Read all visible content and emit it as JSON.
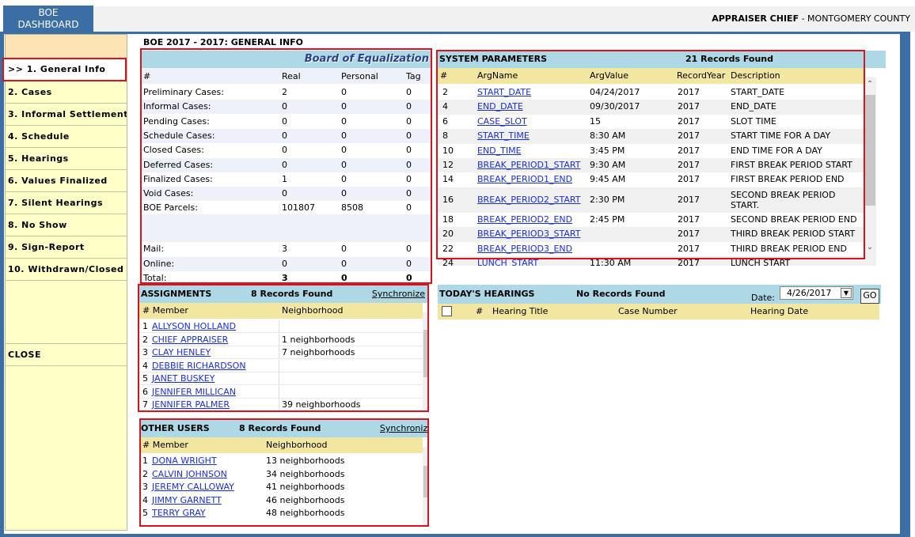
{
  "header": {
    "logo_line1": "BOE",
    "logo_line2": "DASHBOARD",
    "user_role": "APPRAISER CHIEF",
    "user_county": "- MONTGOMERY COUNTY"
  },
  "sidebar": {
    "active_item": ">> 1. General Info",
    "items": [
      "2. Cases",
      "3. Informal Settlements",
      "4. Schedule",
      "5. Hearings",
      "6. Values Finalized",
      "7. Silent Hearings",
      "8. No Show",
      "9. Sign-Report",
      "10. Withdrawn/Closed"
    ],
    "close_label": "CLOSE"
  },
  "page_title": "BOE 2017 - 2017: GENERAL INFO",
  "board": {
    "title": "Board of Equalization",
    "columns": [
      "#",
      "Real",
      "Personal",
      "Tag"
    ],
    "rows": [
      [
        "Preliminary Cases:",
        "2",
        "0",
        "0"
      ],
      [
        "Informal Cases:",
        "0",
        "0",
        "0"
      ],
      [
        "Pending Cases:",
        "0",
        "0",
        "0"
      ],
      [
        "Schedule Cases:",
        "0",
        "0",
        "0"
      ],
      [
        "Closed Cases:",
        "0",
        "0",
        "0"
      ],
      [
        "Deferred Cases:",
        "0",
        "0",
        "0"
      ],
      [
        "Finalized Cases:",
        "1",
        "0",
        "0"
      ],
      [
        "Void Cases:",
        "0",
        "0",
        "0"
      ],
      [
        "BOE Parcels:",
        "101807",
        "8508",
        "0"
      ]
    ],
    "rows2": [
      [
        "Mail:",
        "3",
        "0",
        "0"
      ],
      [
        "Online:",
        "0",
        "0",
        "0"
      ],
      [
        "Total:",
        "3",
        "0",
        "0"
      ]
    ]
  },
  "system_parameters": {
    "title": "SYSTEM PARAMETERS",
    "count": "21 Records Found",
    "columns": [
      "#",
      "ArgName",
      "ArgValue",
      "RecordYear",
      "Description"
    ],
    "rows": [
      [
        "2",
        "START_DATE",
        "04/24/2017",
        "2017",
        "START_DATE"
      ],
      [
        "4",
        "END_DATE",
        "09/30/2017",
        "2017",
        "END_DATE"
      ],
      [
        "6",
        "CASE_SLOT",
        "15",
        "2017",
        "SLOT TIME"
      ],
      [
        "8",
        "START_TIME",
        "8:30 AM",
        "2017",
        "START TIME FOR A DAY"
      ],
      [
        "10",
        "END_TIME",
        "3:45 PM",
        "2017",
        "END TIME FOR A DAY"
      ],
      [
        "12",
        "BREAK_PERIOD1_START",
        "9:30 AM",
        "2017",
        "FIRST BREAK PERIOD START"
      ],
      [
        "14",
        "BREAK_PERIOD1_END",
        "9:45 AM",
        "2017",
        "FIRST BREAK PERIOD END"
      ],
      [
        "16",
        "BREAK_PERIOD2_START",
        "2:30 PM",
        "2017",
        "SECOND BREAK PERIOD START."
      ],
      [
        "18",
        "BREAK_PERIOD2_END",
        "2:45 PM",
        "2017",
        "SECOND BREAK PERIOD END"
      ],
      [
        "20",
        "BREAK_PERIOD3_START",
        "",
        "2017",
        "THIRD BREAK PERIOD START"
      ],
      [
        "22",
        "BREAK_PERIOD3_END",
        "",
        "2017",
        "THIRD BREAK PERIOD END"
      ],
      [
        "24",
        "LUNCH_START",
        "11:30 AM",
        "2017",
        "LUNCH START"
      ]
    ]
  },
  "assignments": {
    "title": "ASSIGNMENTS",
    "count": "8 Records Found",
    "sync_label": "Synchronize",
    "columns": [
      "# Member",
      "Neighborhood"
    ],
    "rows": [
      [
        "1",
        "ALLYSON HOLLAND",
        ""
      ],
      [
        "2",
        "CHIEF APPRAISER",
        "1 neighborhoods"
      ],
      [
        "3",
        "CLAY HENLEY",
        "7 neighborhoods"
      ],
      [
        "4",
        "DEBBIE RICHARDSON",
        ""
      ],
      [
        "5",
        "JANET BUSKEY",
        ""
      ],
      [
        "6",
        "JENNIFER MILLICAN",
        ""
      ],
      [
        "7",
        "JENNIFER PALMER",
        "39 neighborhoods"
      ]
    ]
  },
  "other_users": {
    "title": "OTHER USERS",
    "count": "8 Records Found",
    "sync_label": "Synchronize",
    "columns": [
      "# Member",
      "Neighborhood"
    ],
    "rows": [
      [
        "1",
        "DONA WRIGHT",
        "13 neighborhoods"
      ],
      [
        "2",
        "CALVIN JOHNSON",
        "34 neighborhoods"
      ],
      [
        "3",
        "JEREMY CALLOWAY",
        "41 neighborhoods"
      ],
      [
        "4",
        "JIMMY GARNETT",
        "46 neighborhoods"
      ],
      [
        "5",
        "TERRY GRAY",
        "48 neighborhoods"
      ]
    ]
  },
  "hearings": {
    "title": "TODAY'S HEARINGS",
    "count": "No Records Found",
    "date_label": "Date:",
    "date_value": "4/26/2017",
    "go_label": "GO",
    "columns": [
      "#",
      "Hearing Title",
      "Case Number",
      "Hearing Date"
    ]
  },
  "icons": {
    "scroll_up": "chevron-up-icon",
    "scroll_down": "chevron-down-icon",
    "dropdown": "dropdown-arrow-icon"
  },
  "colors": {
    "frame_blue": "#3a6ea5",
    "header_blue": "#add8e6",
    "column_header_yellow": "#f2e6a0",
    "sidebar_yellow": "#ffffc8",
    "highlight_red": "#d8151f",
    "link_blue": "#1a2fd0"
  }
}
